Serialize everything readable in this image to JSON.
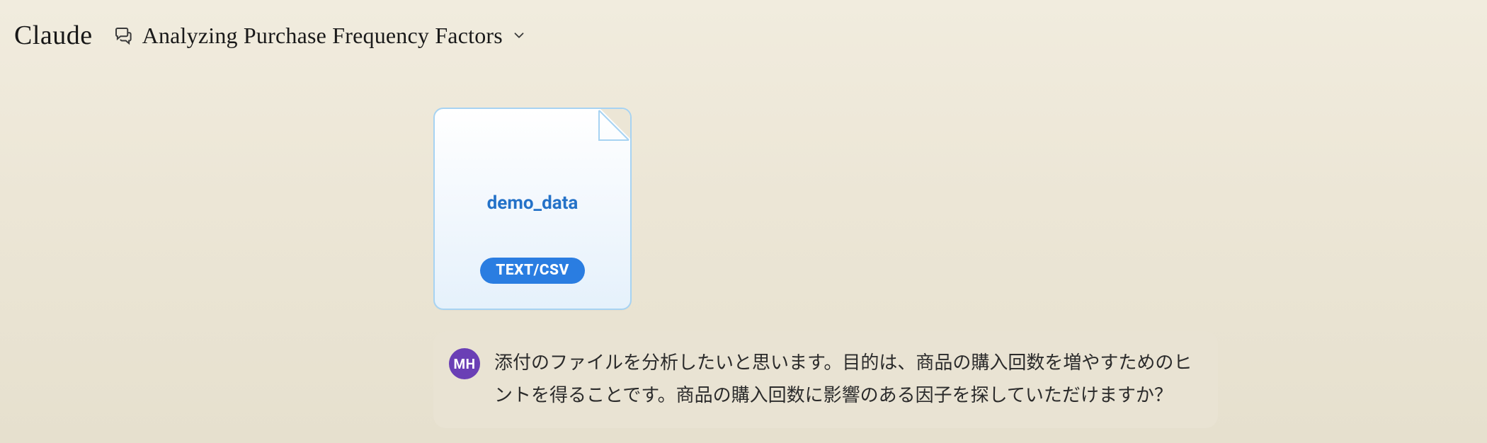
{
  "header": {
    "logo": "Claude",
    "conversation_title": "Analyzing Purchase Frequency Factors"
  },
  "attachment": {
    "name": "demo_data",
    "badge": "TEXT/CSV"
  },
  "message": {
    "avatar_initials": "MH",
    "text": "添付のファイルを分析したいと思います。目的は、商品の購入回数を増やすためのヒントを得ることです。商品の購入回数に影響のある因子を探していただけますか？"
  }
}
